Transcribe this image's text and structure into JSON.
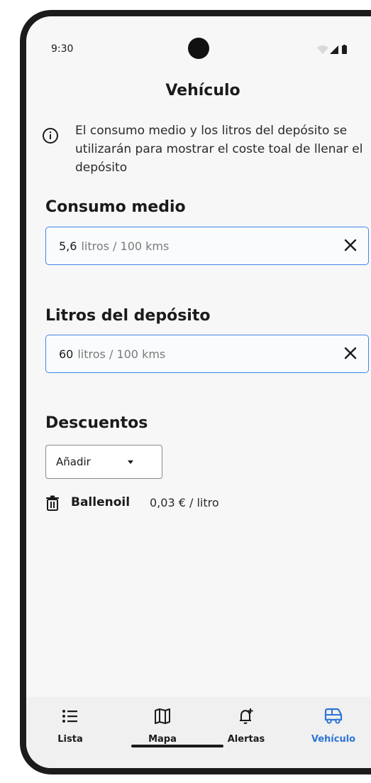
{
  "status_bar": {
    "time": "9:30"
  },
  "header": {
    "title": "Vehículo"
  },
  "info": {
    "icon": "info-icon",
    "text": "El consumo medio y los litros del depósito se utilizarán para mostrar el coste toal de llenar el depósito"
  },
  "consumo": {
    "title": "Consumo medio",
    "value": "5,6",
    "unit": "litros / 100 kms"
  },
  "deposito": {
    "title": "Litros del depósito",
    "value": "60",
    "unit": "litros / 100 kms"
  },
  "descuentos": {
    "title": "Descuentos",
    "select_label": "Añadir",
    "items": [
      {
        "name": "Ballenoil",
        "price": "0,03 € / litro"
      }
    ]
  },
  "nav": {
    "items": [
      {
        "label": "Lista",
        "icon": "list-icon"
      },
      {
        "label": "Mapa",
        "icon": "map-icon"
      },
      {
        "label": "Alertas",
        "icon": "alert-add-icon"
      },
      {
        "label": "Vehículo",
        "icon": "vehicle-icon",
        "active": true
      }
    ],
    "active_color": "#2d74d8"
  },
  "colors": {
    "accent": "#3f86e6",
    "background": "#f7f7f8",
    "nav_background": "#f0f0f0"
  }
}
